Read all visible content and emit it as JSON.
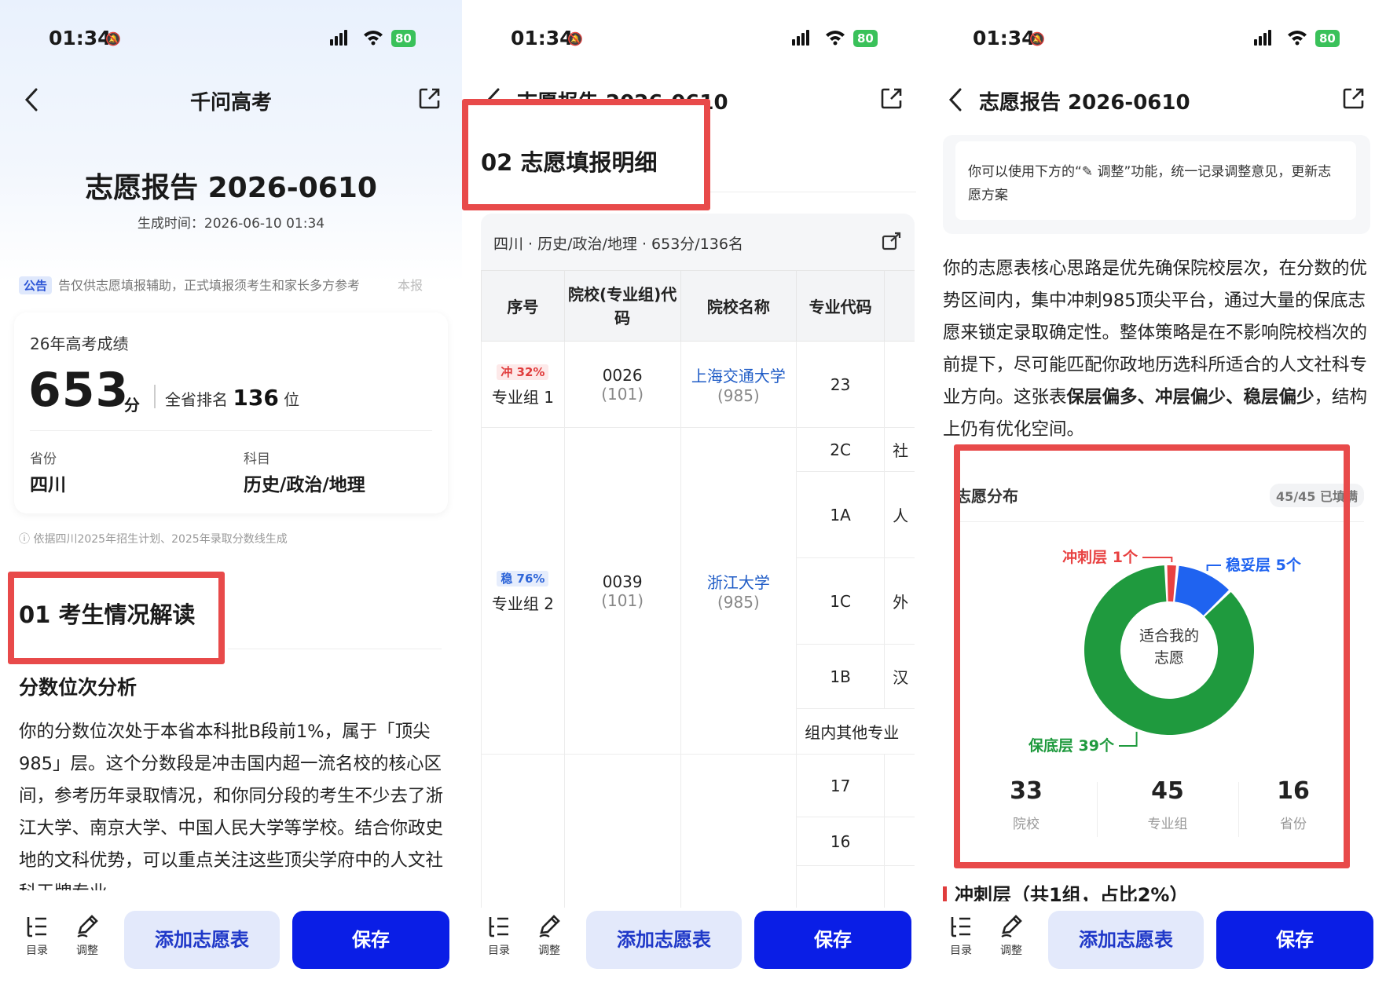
{
  "status": {
    "time": "01:34",
    "battery": "80"
  },
  "toolbar": {
    "catalog_label": "目录",
    "adjust_label": "调整",
    "add_label": "添加志愿表",
    "save_label": "保存"
  },
  "panel1": {
    "nav_title": "千问高考",
    "report_title": "志愿报告 2026-0610",
    "generated_time": "生成时间：2026-06-10 01:34",
    "notice_tag": "公告",
    "notice_text": "告仅供志愿填报辅助，正式填报须考生和家长多方参考",
    "notice_tail": "本报",
    "score_label": "26年高考成绩",
    "score": "653",
    "score_unit": "分",
    "rank_prefix": "全省排名",
    "rank": "136",
    "rank_unit": "位",
    "province_label": "省份",
    "province": "四川",
    "subject_label": "科目",
    "subjects": "历史/政治/地理",
    "source_note": "依据四川2025年招生计划、2025年录取分数线生成",
    "section_title": "01  考生情况解读",
    "sub_title": "分数位次分析",
    "paragraph": "你的分数位次处于本省本科批B段前1%，属于「顶尖985」层。这个分数段是冲击国内超一流名校的核心区间，参考历年录取情况，和你同分段的考生不少去了浙江大学、南京大学、中国人民大学等学校。结合你政史地的文科优势，可以重点关注这些顶尖学府中的人文社科王牌专业"
  },
  "panel2": {
    "nav_title": "志愿报告 2026-0610",
    "section_title": "02  志愿填报明细",
    "table_summary": "四川 · 历史/政治/地理 · 653分/136名",
    "headers": [
      "序号",
      "院校(专业组)代码",
      "院校名称",
      "专业代码"
    ],
    "rows": [
      {
        "badge": "冲 32%",
        "group": "专业组 1",
        "code": "0026",
        "code_sub": "(101)",
        "school": "上海交通大学",
        "school_sub": "(985)",
        "majors": [
          "23"
        ],
        "tails": [
          ""
        ]
      },
      {
        "badge": "稳 76%",
        "group": "专业组 2",
        "code": "0039",
        "code_sub": "(101)",
        "school": "浙江大学",
        "school_sub": "(985)",
        "majors": [
          "2C",
          "1A",
          "1C",
          "1B"
        ],
        "tails": [
          "社",
          "人",
          "外",
          "汉"
        ]
      }
    ],
    "group_other": "组内其他专业",
    "extra_majors": [
      "17",
      "16"
    ]
  },
  "panel3": {
    "nav_title": "志愿报告 2026-0610",
    "tip_text": "你可以使用下方的“✎ 调整”功能，统一记录调整意见，更新志愿方案",
    "paragraph_a": "你的志愿表核心思路是优先确保院校层次，在分数的优势区间内，集中冲刺985顶尖平台，通过大量的保底志愿来锁定录取确定性。整体策略是在不影响院校档次的前提下，尽可能匹配你政地历选科所适合的人文社科专业方向。这张表",
    "paragraph_bold": "保层偏多、冲层偏少、稳层偏少",
    "paragraph_b": "，结构上仍有优化空间。",
    "dist_title": "志愿分布",
    "dist_filled": "45/45 已填满",
    "donut_center_1": "适合我的",
    "donut_center_2": "志愿",
    "stats": [
      {
        "value": "33",
        "label": "院校"
      },
      {
        "value": "45",
        "label": "专业组"
      },
      {
        "value": "16",
        "label": "省份"
      }
    ],
    "cut_heading": "冲刺层（共1组，占比2%）"
  },
  "chart_data": {
    "type": "pie",
    "categories": [
      "冲刺层",
      "稳妥层",
      "保底层"
    ],
    "values": [
      1,
      5,
      39
    ],
    "labels": [
      "冲刺层 1个",
      "稳妥层 5个",
      "保底层 39个"
    ],
    "colors": [
      "#e84141",
      "#1f63f0",
      "#1f9a3e"
    ]
  }
}
